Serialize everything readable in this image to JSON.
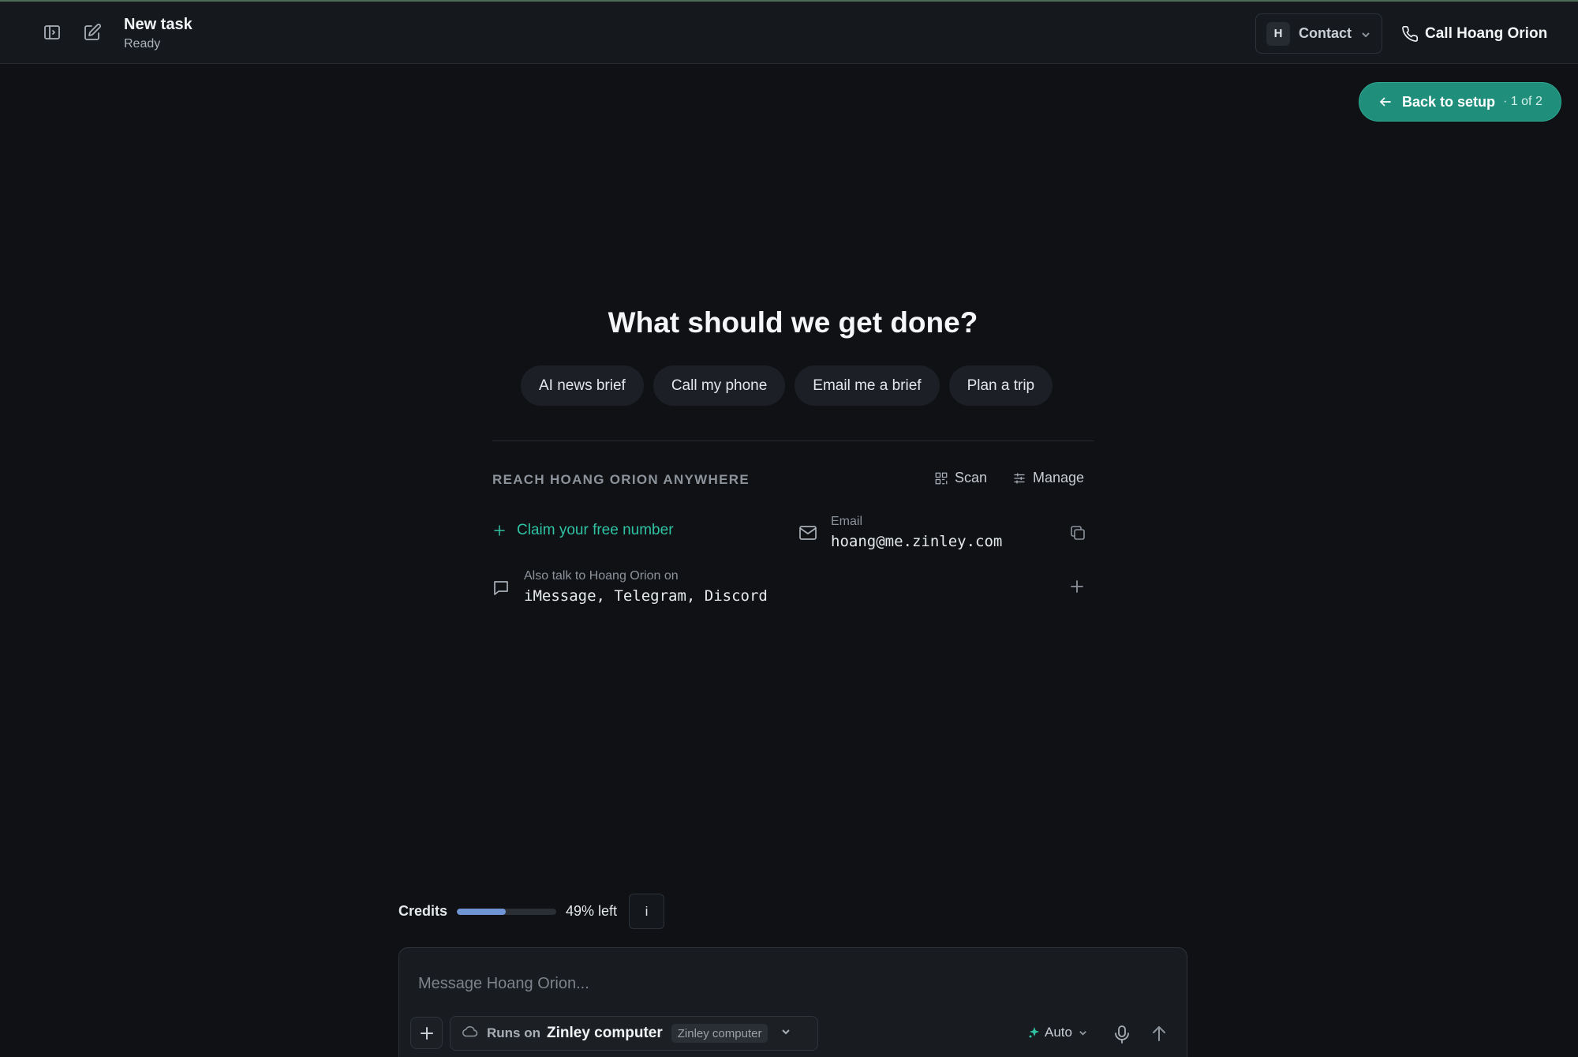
{
  "header": {
    "task_title": "New task",
    "task_status": "Ready",
    "contact": {
      "avatar_initial": "H",
      "label": "Contact"
    },
    "call_label": "Call Hoang Orion"
  },
  "setup": {
    "back_label": "Back to setup",
    "step": "· 1 of 2"
  },
  "hero": {
    "title": "What should we get done?",
    "suggestions": [
      "AI news brief",
      "Call my phone",
      "Email me a brief",
      "Plan a trip"
    ]
  },
  "reach": {
    "title": "REACH HOANG ORION ANYWHERE",
    "scan_label": "Scan",
    "manage_label": "Manage",
    "claim_label": "Claim your free number",
    "email_caption": "Email",
    "email_value": "hoang@me.zinley.com",
    "also_caption": "Also talk to Hoang Orion on",
    "also_value": "iMessage, Telegram, Discord"
  },
  "credits": {
    "label": "Credits",
    "remaining_fraction": 0.49,
    "left_label": "49% left",
    "info_label": "i"
  },
  "composer": {
    "placeholder": "Message Hoang Orion...",
    "runs_prefix": "Runs on",
    "runs_name": "Zinley computer",
    "runs_badge": "Zinley computer",
    "mode_label": "Auto"
  },
  "colors": {
    "accent": "#1f8f7c",
    "accent_text": "#2fc3a3",
    "credits_fill": "#6f95d4",
    "background": "#0f1115"
  },
  "icons": [
    "sidebar-toggle-icon",
    "compose-icon",
    "chevron-down-icon",
    "phone-icon",
    "arrow-left-icon",
    "scan-icon",
    "sliders-icon",
    "plus-icon",
    "mail-icon",
    "copy-icon",
    "chat-bubble-icon",
    "cloud-icon",
    "sparkle-icon",
    "microphone-icon",
    "arrow-up-icon"
  ]
}
